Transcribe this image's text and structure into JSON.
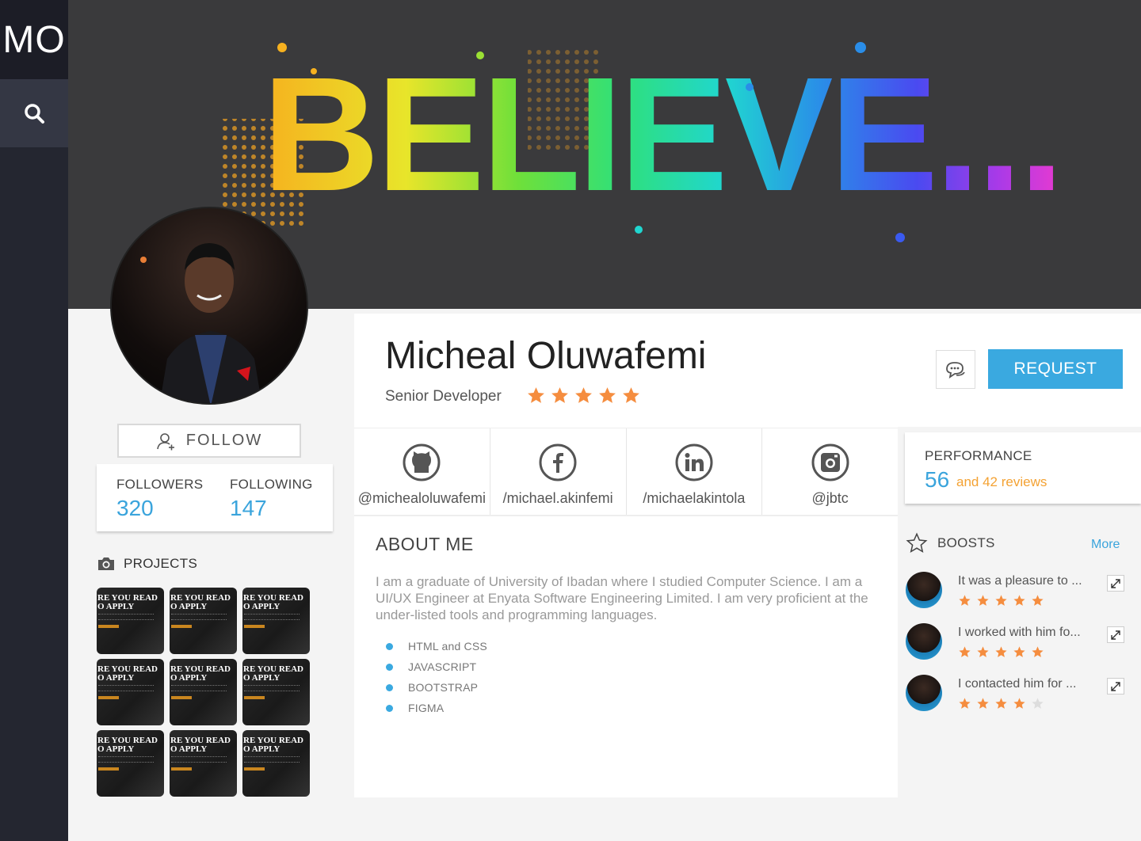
{
  "sidebar": {
    "logo": "MO",
    "search_icon": "search-icon"
  },
  "banner": {
    "text": "BELIEVE..."
  },
  "profile": {
    "name": "Micheal Oluwafemi",
    "role": "Senior Developer",
    "rating": 5,
    "follow_label": "FOLLOW",
    "followers_label": "FOLLOWERS",
    "followers_count": "320",
    "following_label": "FOLLOWING",
    "following_count": "147"
  },
  "actions": {
    "chat_icon": "chat-icon",
    "request_label": "REQUEST"
  },
  "socials": [
    {
      "icon": "github-icon",
      "handle": "@michealoluwafemi"
    },
    {
      "icon": "facebook-icon",
      "handle": "/michael.akinfemi"
    },
    {
      "icon": "linkedin-icon",
      "handle": "/michaelakintola"
    },
    {
      "icon": "instagram-icon",
      "handle": "@jbtc"
    }
  ],
  "projects": {
    "title": "PROJECTS",
    "thumb_line1": "RE YOU READ",
    "thumb_line2": "O APPLY",
    "count": 9
  },
  "about": {
    "title": "ABOUT ME",
    "text": "I am a graduate of University of Ibadan where I studied Computer Science. I am a UI/UX Engineer at Enyata Software Engineering Limited. I am very proficient at the under-listed tools and programming languages.",
    "skills": [
      "HTML and CSS",
      "JAVASCRIPT",
      "BOOTSTRAP",
      "FIGMA"
    ]
  },
  "performance": {
    "label": "PERFORMANCE",
    "score": "56",
    "reviews": "and 42 reviews"
  },
  "boosts": {
    "title": "BOOSTS",
    "more_label": "More",
    "items": [
      {
        "text": "It was a pleasure to ...",
        "rating": 5
      },
      {
        "text": "I worked with him fo...",
        "rating": 5
      },
      {
        "text": "I contacted him for ...",
        "rating": 4
      }
    ]
  },
  "colors": {
    "accent": "#3aa9e0",
    "star": "#f58d3f",
    "star_empty": "#dddddd",
    "sidebar": "#242630"
  }
}
